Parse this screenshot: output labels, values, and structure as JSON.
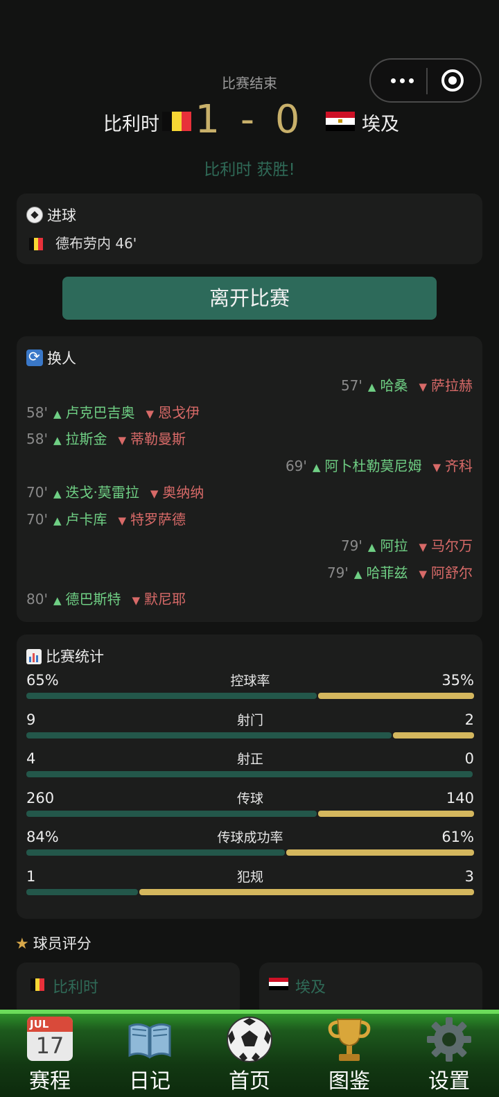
{
  "header": {
    "status": "比赛结束",
    "home_team": "比利时",
    "away_team": "埃及",
    "score": "1 - 0",
    "result_text": "比利时 获胜!"
  },
  "goals": {
    "title": "进球",
    "items": [
      {
        "player": "德布劳内 46'"
      }
    ]
  },
  "leave_button": "离开比赛",
  "substitutions": {
    "title": "换人",
    "items": [
      {
        "side": "right",
        "minute": "57'",
        "in": "哈桑",
        "out": "萨拉赫"
      },
      {
        "side": "left",
        "minute": "58'",
        "in": "卢克巴吉奥",
        "out": "恩戈伊"
      },
      {
        "side": "left",
        "minute": "58'",
        "in": "拉斯金",
        "out": "蒂勒曼斯"
      },
      {
        "side": "right",
        "minute": "69'",
        "in": "阿卜杜勒莫尼姆",
        "out": "齐科"
      },
      {
        "side": "left",
        "minute": "70'",
        "in": "迭戈·莫雷拉",
        "out": "奥纳纳"
      },
      {
        "side": "left",
        "minute": "70'",
        "in": "卢卡库",
        "out": "特罗萨德"
      },
      {
        "side": "right",
        "minute": "79'",
        "in": "阿拉",
        "out": "马尔万"
      },
      {
        "side": "right",
        "minute": "79'",
        "in": "哈菲兹",
        "out": "阿舒尔"
      },
      {
        "side": "left",
        "minute": "80'",
        "in": "德巴斯特",
        "out": "默尼耶"
      }
    ]
  },
  "stats": {
    "title": "比赛统计",
    "items": [
      {
        "name": "控球率",
        "home": "65%",
        "away": "35%",
        "home_share": 0.65
      },
      {
        "name": "射门",
        "home": "9",
        "away": "2",
        "home_share": 0.818
      },
      {
        "name": "射正",
        "home": "4",
        "away": "0",
        "home_share": 1.0
      },
      {
        "name": "传球",
        "home": "260",
        "away": "140",
        "home_share": 0.65
      },
      {
        "name": "传球成功率",
        "home": "84%",
        "away": "61%",
        "home_share": 0.579
      },
      {
        "name": "犯规",
        "home": "1",
        "away": "3",
        "home_share": 0.25
      }
    ]
  },
  "ratings": {
    "title": "球员评分",
    "home_team": "比利时",
    "away_team": "埃及"
  },
  "nav": {
    "items": [
      {
        "label": "赛程",
        "calendar_month": "JUL",
        "calendar_day": "17"
      },
      {
        "label": "日记"
      },
      {
        "label": "首页"
      },
      {
        "label": "图鉴"
      },
      {
        "label": "设置"
      }
    ]
  },
  "colors": {
    "accent_green": "#2d6a5a",
    "score_gold": "#c8b06a",
    "home_bar": "#23574a",
    "away_bar": "#d4b75e",
    "sub_in": "#6fcf84",
    "sub_out": "#d86a68"
  },
  "icons": [
    "more-dots-icon",
    "target-icon",
    "soccer-ball-icon",
    "swap-icon",
    "bar-chart-icon",
    "star-icon",
    "calendar-icon",
    "book-icon",
    "soccer-ball-icon",
    "trophy-icon",
    "gear-icon"
  ]
}
